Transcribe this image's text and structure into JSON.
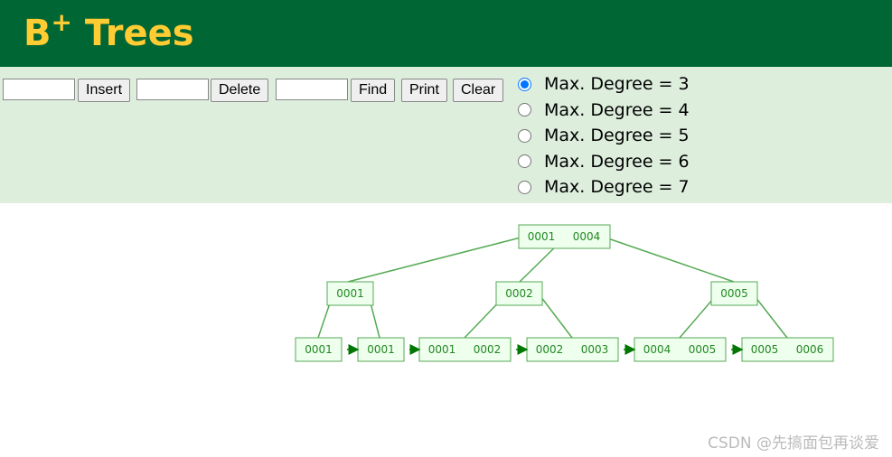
{
  "header": {
    "title": "B",
    "title_sup": "+",
    "title_rest": " Trees"
  },
  "controls": {
    "insert_value": "",
    "insert_label": "Insert",
    "delete_value": "",
    "delete_label": "Delete",
    "find_value": "",
    "find_label": "Find",
    "print_label": "Print",
    "clear_label": "Clear",
    "degrees": [
      {
        "label": "Max. Degree = 3",
        "checked": true
      },
      {
        "label": "Max. Degree = 4",
        "checked": false
      },
      {
        "label": "Max. Degree = 5",
        "checked": false
      },
      {
        "label": "Max. Degree = 6",
        "checked": false
      },
      {
        "label": "Max. Degree = 7",
        "checked": false
      }
    ]
  },
  "tree": {
    "colors": {
      "stroke": "#55aa55",
      "fill": "#eeffee",
      "text": "#228822",
      "arrow": "#007700"
    },
    "root": [
      "0001",
      "0004"
    ],
    "internal": [
      [
        "0001"
      ],
      [
        "0002"
      ],
      [
        "0005"
      ]
    ],
    "leaves": [
      [
        "0001"
      ],
      [
        "0001"
      ],
      [
        "0001",
        "0002"
      ],
      [
        "0002",
        "0003"
      ],
      [
        "0004",
        "0005"
      ],
      [
        "0005",
        "0006"
      ]
    ]
  },
  "watermark": "CSDN @先搞面包再谈爱"
}
